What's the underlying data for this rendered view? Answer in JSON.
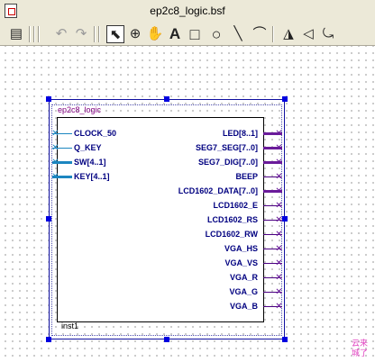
{
  "window": {
    "title": "ep2c8_logic.bsf"
  },
  "toolbar": {
    "icons": [
      "block-properties-icon",
      "undo-icon",
      "redo-icon",
      "selection-tool-icon",
      "zoom-tool-icon",
      "hand-tool-icon",
      "text-tool-icon",
      "rectangle-tool-icon",
      "ellipse-tool-icon",
      "line-tool-icon",
      "arc-tool-icon",
      "flip-horizontal-icon",
      "flip-vertical-icon",
      "rotate-icon"
    ],
    "glyphs": {
      "block_properties": "▤",
      "undo": "↶",
      "redo": "↷",
      "select": "⬉",
      "zoom": "⊕",
      "hand": "✋",
      "text": "A",
      "rect": "□",
      "ellipse": "○",
      "line": "╲",
      "arc": "⌒",
      "flip_h": "◮",
      "flip_v": "◁",
      "rotate": "⤿"
    },
    "active_tool": "selection-tool"
  },
  "symbol": {
    "name": "ep2c8_logic",
    "instance": "inst1",
    "inputs": [
      {
        "label": "CLOCK_50",
        "bus": false
      },
      {
        "label": "Q_KEY",
        "bus": false
      },
      {
        "label": "SW[4..1]",
        "bus": true
      },
      {
        "label": "KEY[4..1]",
        "bus": true
      }
    ],
    "outputs": [
      {
        "label": "LED[8..1]",
        "bus": true
      },
      {
        "label": "SEG7_SEG[7..0]",
        "bus": true
      },
      {
        "label": "SEG7_DIG[7..0]",
        "bus": true
      },
      {
        "label": "BEEP",
        "bus": false
      },
      {
        "label": "LCD1602_DATA[7..0]",
        "bus": true
      },
      {
        "label": "LCD1602_E",
        "bus": false
      },
      {
        "label": "LCD1602_RS",
        "bus": false
      },
      {
        "label": "LCD1602_RW",
        "bus": false
      },
      {
        "label": "VGA_HS",
        "bus": false
      },
      {
        "label": "VGA_VS",
        "bus": false
      },
      {
        "label": "VGA_R",
        "bus": false
      },
      {
        "label": "VGA_G",
        "bus": false
      },
      {
        "label": "VGA_B",
        "bus": false
      }
    ],
    "pin_mark": "✕"
  },
  "colors": {
    "input_wire": "#1c86c0",
    "output_wire": "#6a1b9a",
    "pin_label": "#000080",
    "symbol_name": "#800080",
    "selection_handle": "#0000e0",
    "watermark": "#e040c0"
  },
  "watermark": {
    "chars": [
      "云",
      "来",
      "城",
      "了"
    ]
  }
}
